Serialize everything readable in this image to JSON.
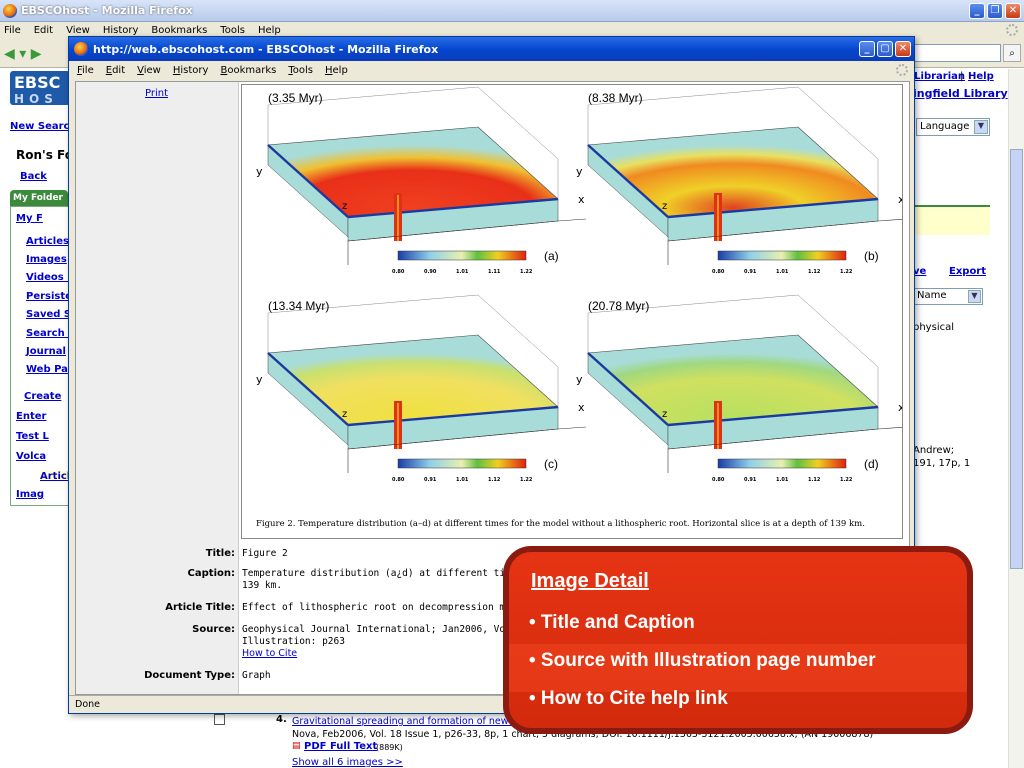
{
  "outer_window": {
    "title": "EBSCOhost - Mozilla Firefox",
    "menu": [
      "File",
      "Edit",
      "View",
      "History",
      "Bookmarks",
      "Tools",
      "Help"
    ]
  },
  "background_page": {
    "logo_line1": "EBSC",
    "logo_line2": "HOS",
    "header_links": {
      "librarian": "-Librarian",
      "sep": "|",
      "help": "Help",
      "library": "ingfield Library"
    },
    "new_search": "New Search",
    "folder_title": "Ron's Fo",
    "back": "Back",
    "my_folder_tab": "My Folder",
    "sidebar_items": [
      "My F",
      "Articles",
      "Images",
      "Videos (",
      "Persiste",
      "Saved S",
      "Search A",
      "Journal",
      "Web Pa",
      "Create",
      "Enter",
      "Test L",
      "Volca",
      "Articl",
      "Imag"
    ],
    "language_select": "Language",
    "save_link": "ve",
    "export_link": "Export",
    "sort_select": "Name",
    "right_text_1": "physical",
    "right_text_2": "Andrew;",
    "right_text_3": "191, 17p, 1",
    "result_number": "4.",
    "result_title": "Gravitational spreading and formation of new rif",
    "result_source": "Nova, Feb2006, Vol. 18 Issue 1, p26-33, 8p, 1 chart, 5 diagrams; DOI: 10.1111/j.1365-3121.2005.00658.x; (AN 19006878)",
    "pdf_link": "PDF Full Text",
    "pdf_size": "(889K)",
    "show_all": "Show all 6 images >>"
  },
  "popup": {
    "title": "http://web.ebscohost.com - EBSCOhost - Mozilla Firefox",
    "menu": [
      "File",
      "Edit",
      "View",
      "History",
      "Bookmarks",
      "Tools",
      "Help"
    ],
    "print_link": "Print",
    "status": "Done",
    "figure": {
      "panels": [
        {
          "time": "(3.35 Myr)",
          "label": "(a)",
          "ticks": [
            "0.80",
            "0.90",
            "1.01",
            "1.11",
            "1.22"
          ]
        },
        {
          "time": "(8.38 Myr)",
          "label": "(b)",
          "ticks": [
            "0.80",
            "0.91",
            "1.01",
            "1.12",
            "1.22"
          ]
        },
        {
          "time": "(13.34 Myr)",
          "label": "(c)",
          "ticks": [
            "0.80",
            "0.91",
            "1.01",
            "1.12",
            "1.22"
          ]
        },
        {
          "time": "(20.78 Myr)",
          "label": "(d)",
          "ticks": [
            "0.80",
            "0.91",
            "1.01",
            "1.12",
            "1.22"
          ]
        }
      ],
      "axis_x": "x",
      "axis_y": "y",
      "axis_z": "z",
      "caption": "Figure 2.  Temperature distribution (a–d) at different times for the model without a lithospheric root. Horizontal slice is at a depth of 139 km."
    },
    "meta": {
      "title_label": "Title:",
      "title_value": "Figure 2",
      "caption_label": "Caption:",
      "caption_line1": "Temperature distribution (a¿d) at different times",
      "caption_line2": "139 km.",
      "article_label": "Article Title:",
      "article_value": "Effect of lithospheric root on decompression melti",
      "source_label": "Source:",
      "source_line1": "Geophysical Journal International; Jan2006, Vol. 1",
      "source_line2": "Illustration: p263",
      "how_to_cite": "How to Cite",
      "doctype_label": "Document Type:",
      "doctype_value": "Graph"
    }
  },
  "callout": {
    "title": "Image Detail",
    "items": [
      "• Title and Caption",
      "• Source with Illustration page number",
      "• How to Cite help link"
    ]
  },
  "colors": {
    "callout_red": "#e53414",
    "callout_border": "#8b1a10",
    "xp_blue": "#0548d0"
  }
}
